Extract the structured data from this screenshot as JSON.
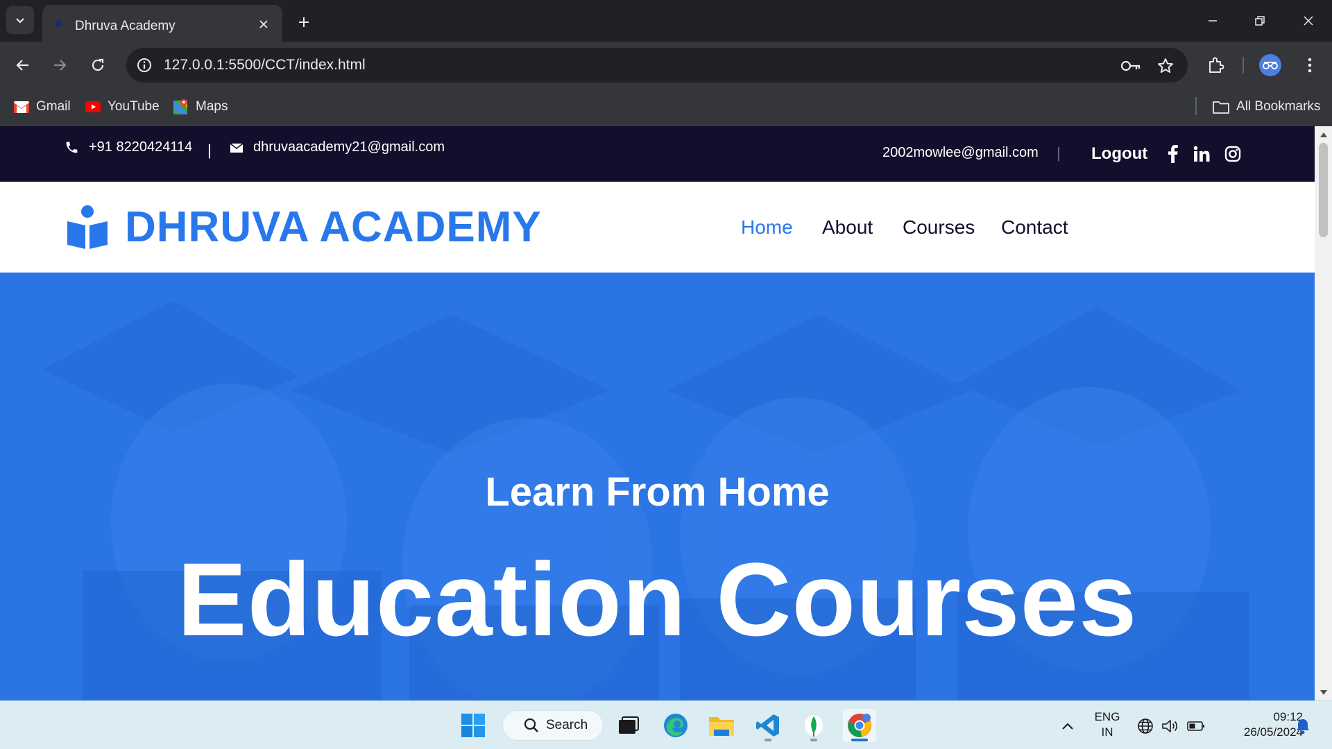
{
  "browser": {
    "tab_title": "Dhruva Academy",
    "url": "127.0.0.1:5500/CCT/index.html",
    "bookmarks": [
      {
        "label": "Gmail",
        "icon": "gmail-icon"
      },
      {
        "label": "YouTube",
        "icon": "youtube-icon"
      },
      {
        "label": "Maps",
        "icon": "maps-icon"
      }
    ],
    "all_bookmarks_label": "All Bookmarks"
  },
  "topbar": {
    "phone": "+91 8220424114",
    "separator": "|",
    "email": "dhruvaacademy21@gmail.com",
    "user_email": "2002mowlee@gmail.com",
    "logout_label": "Logout",
    "social": [
      "facebook-icon",
      "linkedin-icon",
      "instagram-icon"
    ]
  },
  "navbar": {
    "brand": "DHRUVA ACADEMY",
    "links": [
      {
        "label": "Home",
        "active": true
      },
      {
        "label": "About",
        "active": false
      },
      {
        "label": "Courses",
        "active": false
      },
      {
        "label": "Contact",
        "active": false
      }
    ]
  },
  "hero": {
    "subtitle": "Learn From Home",
    "title": "Education Courses"
  },
  "taskbar": {
    "search_label": "Search",
    "language": "ENG",
    "region": "IN",
    "time": "09:12",
    "date": "26/05/2024"
  },
  "colors": {
    "primary": "#2878eb",
    "dark": "#120f2d",
    "hero_overlay": "#2a74e4"
  }
}
